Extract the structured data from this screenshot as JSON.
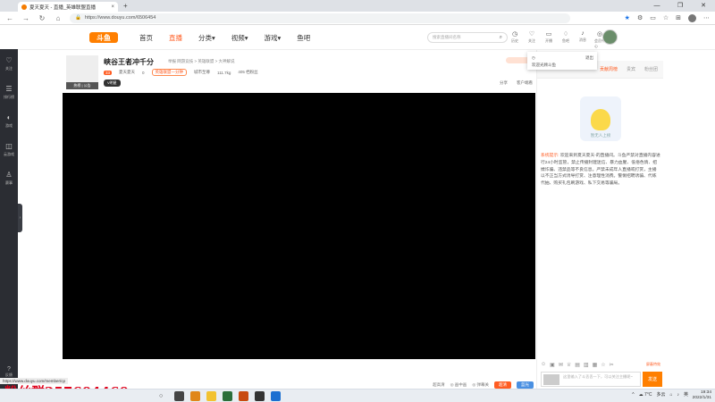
{
  "browser": {
    "tab_title": "夏天夏天 - 直播_英雄联盟直播",
    "tab_close": "×",
    "new_tab": "+",
    "url": "https://www.douyu.com/6506454",
    "win_min": "—",
    "win_max": "❐",
    "win_close": "✕",
    "back": "←",
    "forward": "→",
    "reload": "↻",
    "home": "⌂",
    "lock": "🔒",
    "tool_star": "★",
    "tool_ext": "⚙",
    "tool_split": "▭",
    "tool_fav": "☆",
    "tool_col": "⊞",
    "tool_menu": "⋯"
  },
  "site": {
    "logo": "斗鱼",
    "menu": [
      "首页",
      "直播",
      "分类▾",
      "视频▾",
      "游戏▾",
      "鱼吧"
    ],
    "search_placeholder": "搜索直播间名称",
    "search_icon": "⌕",
    "top_icons": [
      {
        "icon": "◷",
        "label": "历史"
      },
      {
        "icon": "♡",
        "label": "关注"
      },
      {
        "icon": "▭",
        "label": "开播"
      },
      {
        "icon": "♢",
        "label": "鱼吧"
      },
      {
        "icon": "♪",
        "label": "消息"
      },
      {
        "icon": "◎",
        "label": "会员中心"
      }
    ]
  },
  "left_sidebar": {
    "items": [
      {
        "icon": "♡",
        "label": "关注"
      },
      {
        "icon": "☰",
        "label": "排行榜"
      },
      {
        "icon": "◐",
        "label": "游戏"
      },
      {
        "icon": "◫",
        "label": "云游戏"
      },
      {
        "icon": "♙",
        "label": "赛事"
      }
    ],
    "bottom": {
      "icon": "?",
      "label": "反馈"
    },
    "collapse": "›"
  },
  "room": {
    "avatar_tag": "热榜 | 公告",
    "title": "峡谷王者冲千分",
    "category": "举报  网游竞技 > 英雄联盟 > 大神解说",
    "level": "33",
    "anchor": "夏天夏天",
    "hot": "0",
    "rank_pill": "英雄联盟一分钟",
    "tag1": "城市至尊",
    "fans": "111.7kg",
    "followers": "405 档粉丝",
    "badge": "V明星",
    "share": "分享",
    "report": "客户端看"
  },
  "side_panel": {
    "tabs": [
      "贡献周榜",
      "贵宾",
      "粉丝团"
    ],
    "mascot_caption": "暂无人上榜",
    "sys_label": "系统提示:",
    "sys_text": "欢迎来到夏天夏天-的直播间。斗鱼严禁对直播内容进行24小时监管，禁止传播封建迷信、暴力血腥、低俗色情、招嫖诈骗、违禁品等不良信息。严禁未成年人直播或打赏，主播以不正当方式诱导打赏、注意理性消费。警惕招聘诱骗、代练代抽、购买礼包刷游戏、私下交易等骗局。",
    "chat_icons": [
      "☺",
      "▣",
      "✉",
      "♕",
      "▤",
      "▥",
      "▦",
      "☆",
      "✂"
    ],
    "chat_right": "屏蔽特效",
    "input_placeholder": "这里输入了斗丢丢一下，可以关注主播呢~",
    "send": "发送"
  },
  "popup": {
    "left": "◷",
    "right": "退出",
    "row": "欢迎光顾斗鱼"
  },
  "video_controls": {
    "items": [
      "超高清",
      "◎ 画中画",
      "◎ 弹幕关",
      "超清",
      "蓝光"
    ]
  },
  "status_url": "https://www.douyu.com/member/cp",
  "watermark": "粉丝群257604460",
  "taskbar": {
    "search_icon": "○",
    "tray": [
      "^",
      "☁ 7°C",
      "多云",
      "⌂",
      "♪",
      "英"
    ],
    "time": "19:34",
    "date": "2022/1/31"
  },
  "colors": {
    "accent": "#ff5d23",
    "logo": "#ff7f00"
  }
}
